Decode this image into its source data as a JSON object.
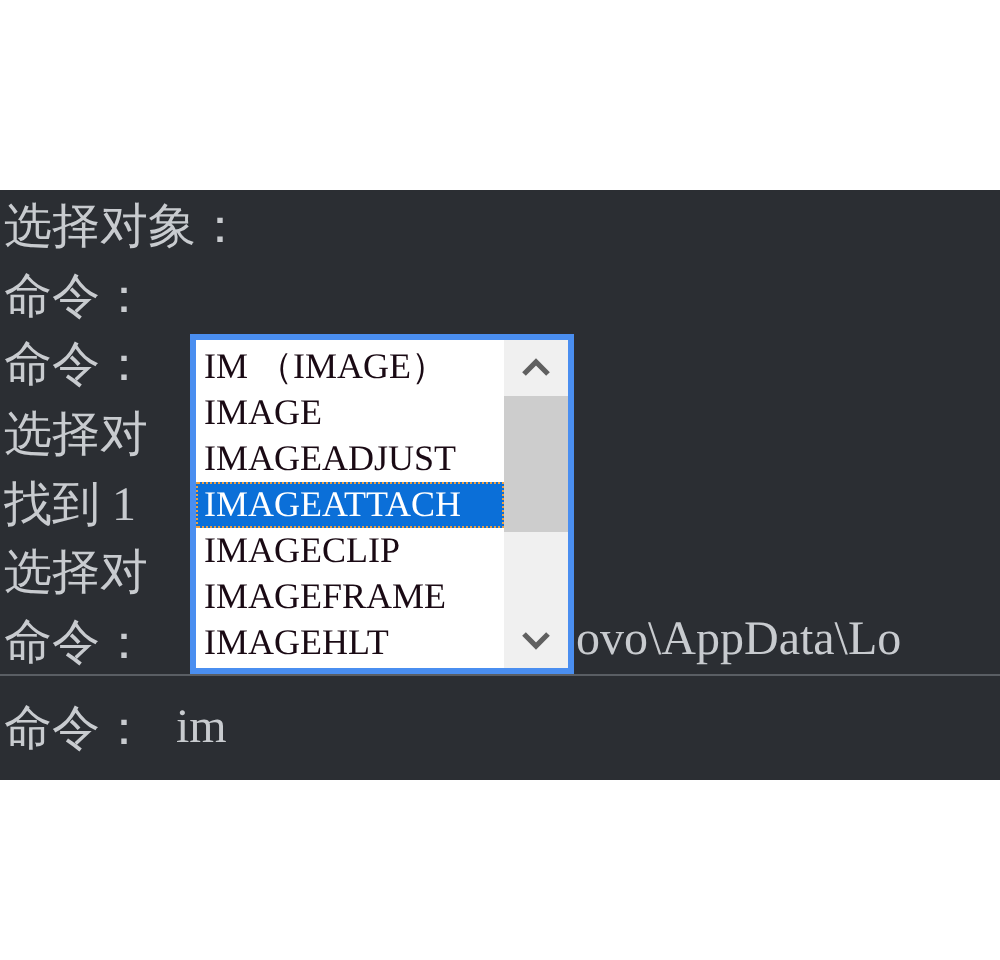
{
  "history": [
    {
      "text": "选择对象："
    },
    {
      "text": "命令："
    },
    {
      "text": "命令："
    },
    {
      "text": "选择对"
    },
    {
      "text": "找到 1"
    },
    {
      "text": "选择对"
    },
    {
      "text": "命令：",
      "tail": "ovo\\AppData\\Lo"
    }
  ],
  "autocomplete": {
    "items": [
      {
        "label": "IM （IMAGE）",
        "selected": false
      },
      {
        "label": "IMAGE",
        "selected": false
      },
      {
        "label": "IMAGEADJUST",
        "selected": false
      },
      {
        "label": "IMAGEATTACH",
        "selected": true
      },
      {
        "label": "IMAGECLIP",
        "selected": false
      },
      {
        "label": "IMAGEFRAME",
        "selected": false
      },
      {
        "label": "IMAGEHLT",
        "selected": false
      }
    ]
  },
  "command_line": {
    "prompt": "命令：",
    "value": "im"
  }
}
